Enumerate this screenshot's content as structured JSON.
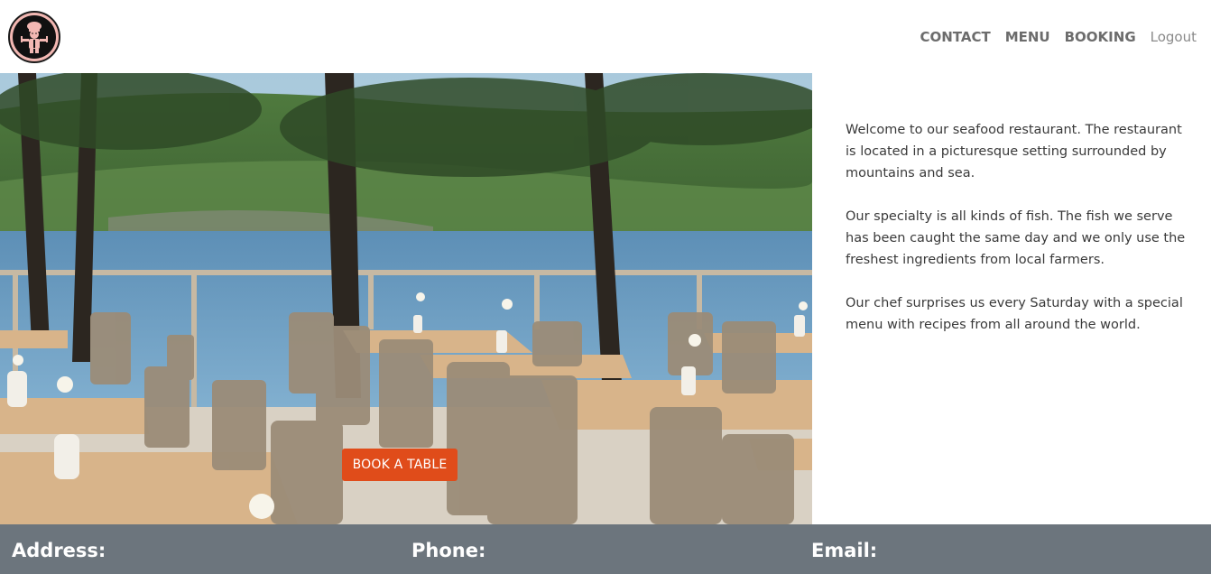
{
  "nav": {
    "logo_icon": "chef-logo-icon",
    "links": [
      {
        "label": "CONTACT"
      },
      {
        "label": "MENU"
      },
      {
        "label": "BOOKING"
      }
    ],
    "logout_label": "Logout"
  },
  "hero": {
    "image_icon": "terrace-photo",
    "book_button_label": "BOOK A TABLE"
  },
  "about": {
    "paragraphs": [
      "Welcome to our seafood restaurant. The restaurant is located in a picturesque setting surrounded by mountains and sea.",
      "Our specialty is all kinds of fish. The fish we serve has been caught the same day and we only use the freshest ingredients from local farmers.",
      "Our chef surprises us every Saturday with a special menu with recipes from all around the world."
    ]
  },
  "footer": {
    "address_label": "Address:",
    "phone_label": "Phone:",
    "email_label": "Email:"
  },
  "colors": {
    "accent_button": "#e04c1a",
    "footer_bg": "#6c757d",
    "nav_text": "#6c6c6c"
  }
}
